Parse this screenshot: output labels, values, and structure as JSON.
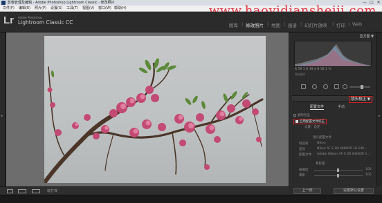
{
  "window": {
    "title": "影像管理及编辑 - Adobe Photoshop Lightroom Classic - 修改照片",
    "controls": [
      "—",
      "□",
      "✕"
    ]
  },
  "menu": {
    "items": [
      "文件(F)",
      "编辑(E)",
      "照片(P)",
      "设置(S)",
      "工具(T)",
      "视图(V)",
      "窗口(W)",
      "帮助(H)"
    ]
  },
  "watermark": "www.haoyidianshejji.com",
  "header": {
    "logo": "Lr",
    "brand_small": "Adobe Photoshop",
    "brand_big": "Lightroom Classic CC",
    "modules": [
      {
        "label": "图库",
        "active": false
      },
      {
        "label": "修改照片",
        "active": true
      },
      {
        "label": "地图",
        "active": false
      },
      {
        "label": "画册",
        "active": false
      },
      {
        "label": "幻灯片放映",
        "active": false
      },
      {
        "label": "打印",
        "active": false
      },
      {
        "label": "Web",
        "active": false
      }
    ]
  },
  "right_panel": {
    "histogram_title": "直方图 ▼",
    "hist_values": "R  59.1   G  39.4   B  58.1  %",
    "hist_check": "原始照片",
    "section_title": "镜头校正 ▼",
    "tabs": [
      "配置文件",
      "手动"
    ],
    "checkboxes": {
      "remove_ca": "删除色差",
      "enable_profile": "启用配置文件校正"
    },
    "setup_label": "设置：",
    "setup_value": "自定",
    "lens_profile_title": "镜头配置文件",
    "make_label": "制造商",
    "make_value": "Nikon",
    "model_label": "型号",
    "model_value": "Nikon AF-S DX NIKKOR 18-140...",
    "profile_label": "配置文件",
    "profile_value": "Adobe (Nikon AF-S DX NIKKOR 1...",
    "amount_title": "晕影量",
    "distortion_label": "扭曲度",
    "distortion_value": "100",
    "vignette_label": "晕影",
    "vignette_value": "100"
  },
  "toolbar": {
    "label": "软打样",
    "prev_button": "上一张",
    "reset_button": "设置默认设置"
  }
}
